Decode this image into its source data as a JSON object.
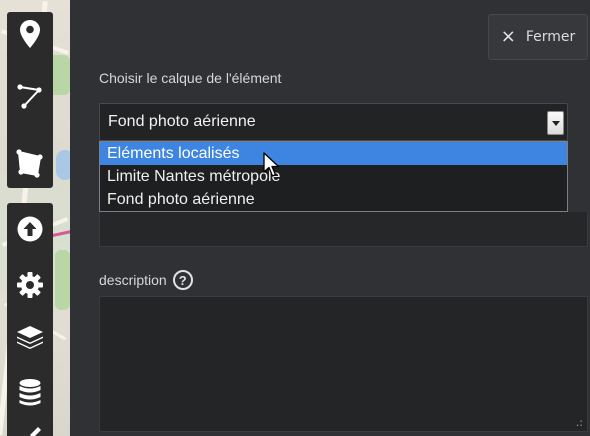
{
  "panel": {
    "close_label": "Fermer",
    "layer_label": "Choisir le calque de l'élément",
    "select_value": "Fond photo aérienne",
    "dropdown_options": [
      "Eléments localisés",
      "Limite Nantes métropole",
      "Fond photo aérienne"
    ],
    "highlighted_option_index": 0,
    "description_label": "description",
    "help_glyph": "?",
    "resize_glyph": ".:"
  },
  "toolbar": {
    "tools": [
      "marker-icon",
      "polyline-icon",
      "polygon-icon",
      "upload-icon",
      "settings-icon",
      "layers-icon",
      "database-icon"
    ]
  },
  "colors": {
    "panel_bg": "#2f3134",
    "toolbar_bg": "#2b2b2b",
    "highlight": "#3d85e0"
  }
}
